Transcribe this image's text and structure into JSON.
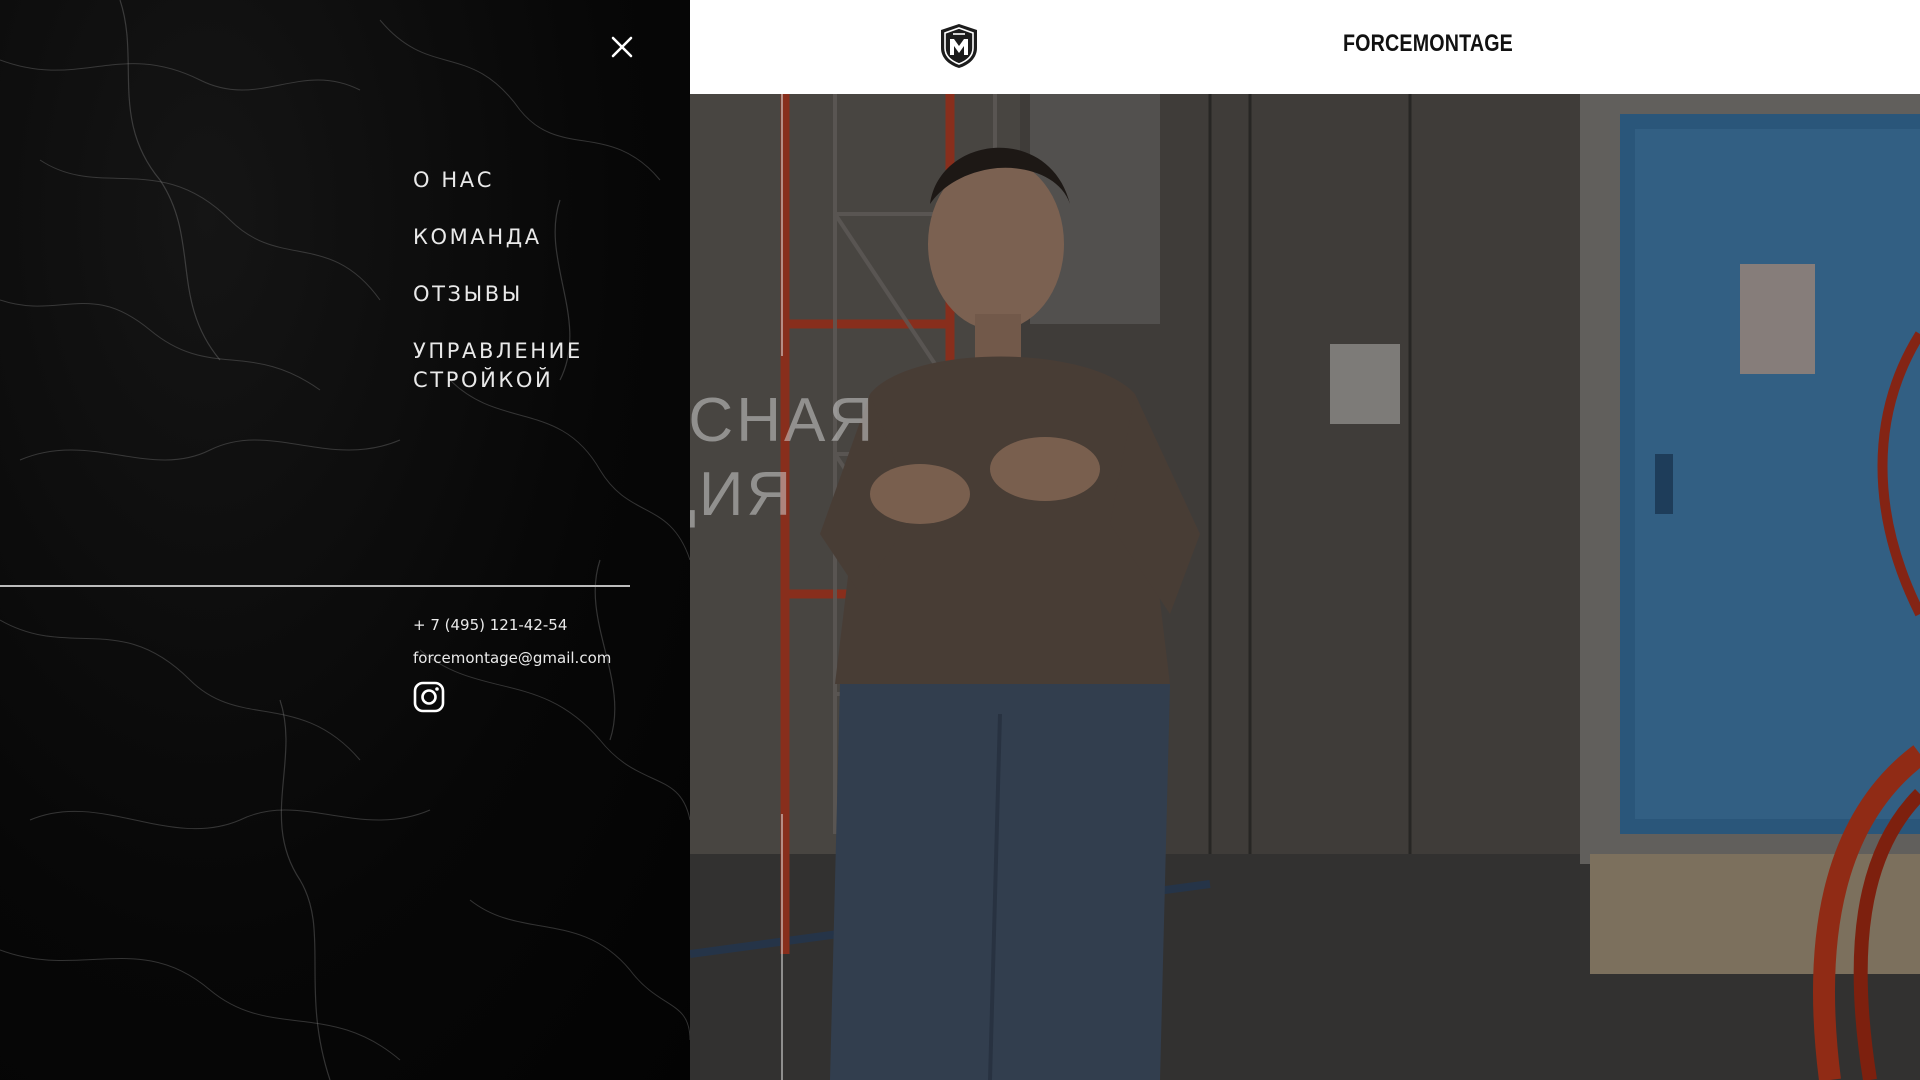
{
  "header": {
    "brand": "FORCEMONTAGE",
    "logo_icon": "shield-logo-icon"
  },
  "hero": {
    "title_line_1": "КСНАЯ",
    "title_line_2": "ЦИЯ"
  },
  "menu": {
    "close_icon": "close-icon",
    "items": [
      {
        "label": "О НАС"
      },
      {
        "label": "КОМАНДА"
      },
      {
        "label": "ОТЗЫВЫ"
      },
      {
        "label": "УПРАВЛЕНИЕ СТРОЙКОЙ"
      }
    ],
    "contacts": {
      "phone": "+ 7 (495) 121-42-54",
      "email": "forcemontage@gmail.com",
      "social_icon": "instagram-icon"
    }
  },
  "colors": {
    "menu_bg": "#050505",
    "header_bg": "#ffffff",
    "accent_door": "#3f88c5",
    "scaffold": "#d2452b"
  }
}
